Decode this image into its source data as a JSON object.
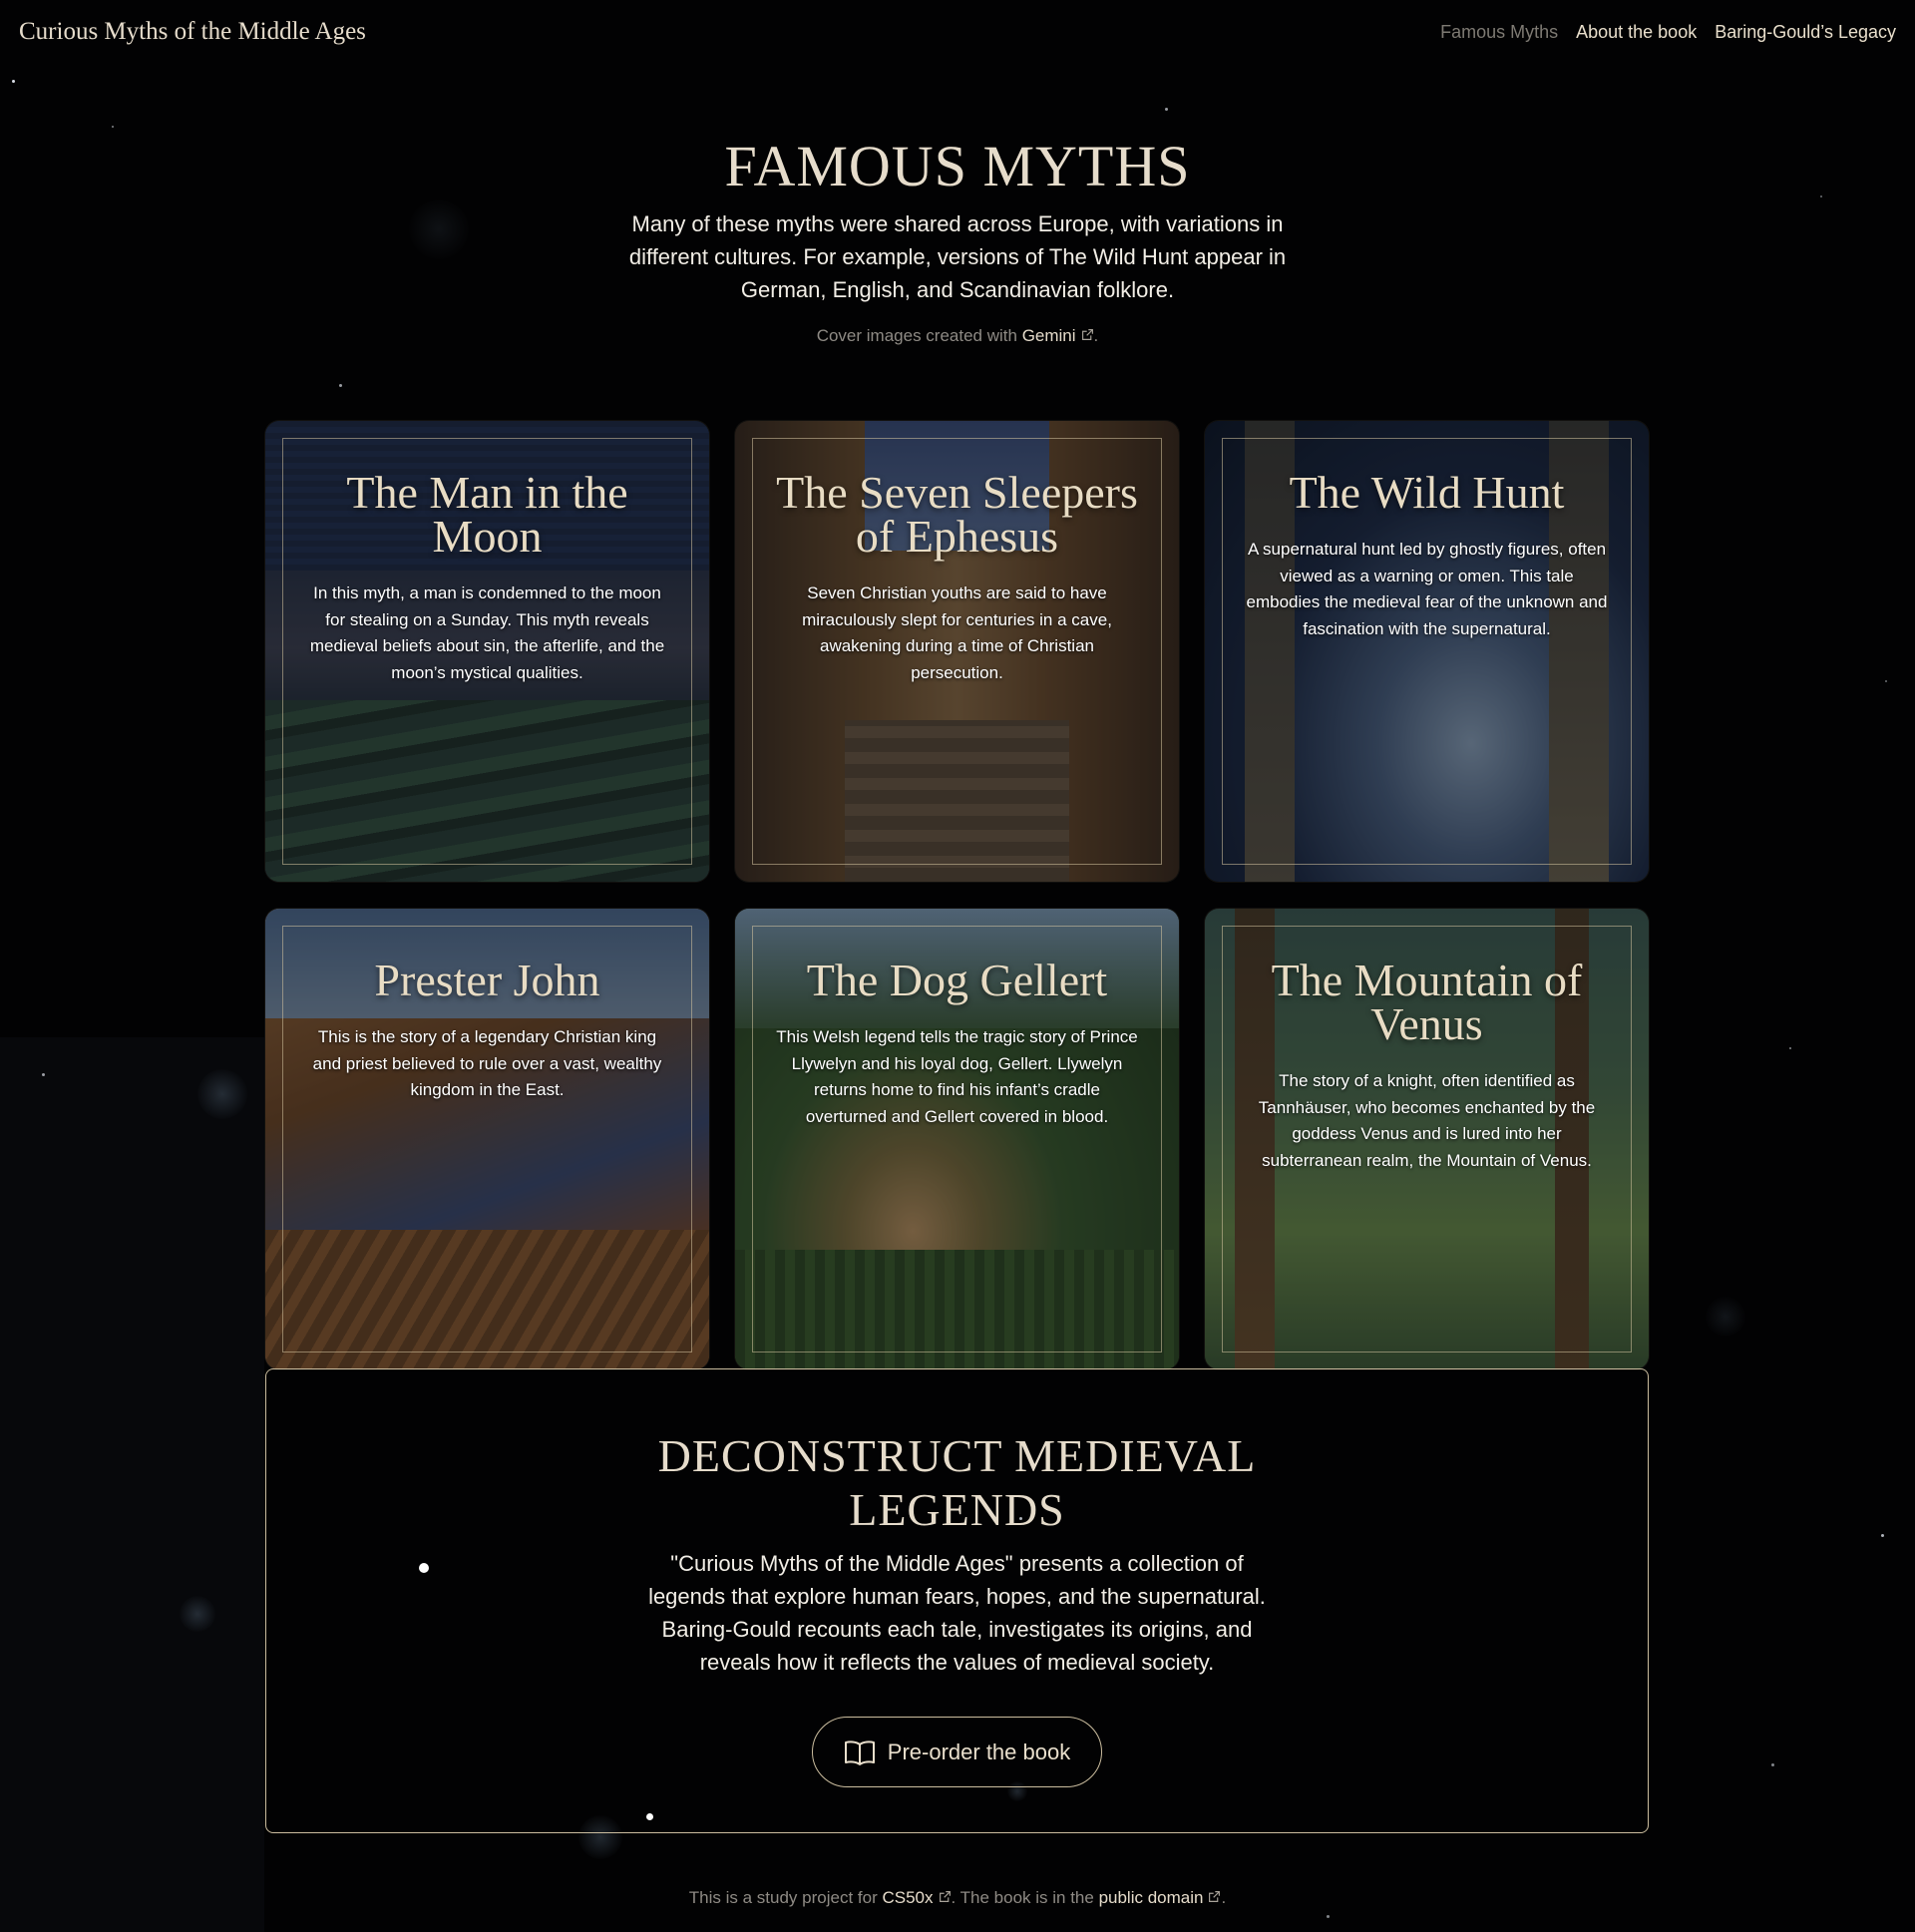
{
  "site": {
    "brand": "Curious Myths of the Middle Ages"
  },
  "nav": [
    {
      "label": "Famous Myths",
      "active": true
    },
    {
      "label": "About the book",
      "active": false
    },
    {
      "label": "Baring-Gould’s Legacy",
      "active": false
    }
  ],
  "intro": {
    "title": "FAMOUS MYTHS",
    "lead": "Many of these myths were shared across Europe, with variations in different cultures. For example, versions of The Wild Hunt appear in German, English, and Scandinavian folklore.",
    "credit_prefix": "Cover images created with ",
    "credit_link": "Gemini",
    "credit_suffix": "."
  },
  "cards": [
    {
      "title": "The Man in the Moon",
      "text": "In this myth, a man is condemned to the moon for stealing on a Sunday. This myth reveals medieval beliefs about sin, the afterlife, and the moon’s mystical qualities."
    },
    {
      "title": "The Seven Sleepers of Ephesus",
      "text": "Seven Christian youths are said to have miraculously slept for centuries in a cave, awakening during a time of Christian persecution."
    },
    {
      "title": "The Wild Hunt",
      "text": "A supernatural hunt led by ghostly figures, often viewed as a warning or omen. This tale embodies the medieval fear of the unknown and fascination with the supernatural."
    },
    {
      "title": "Prester John",
      "text": "This is the story of a legendary Christian king and priest believed to rule over a vast, wealthy kingdom in the East."
    },
    {
      "title": "The Dog Gellert",
      "text": "This Welsh legend tells the tragic story of Prince Llywelyn and his loyal dog, Gellert. Llywelyn returns home to find his infant’s cradle overturned and Gellert covered in blood."
    },
    {
      "title": "The Mountain of Venus",
      "text": "The story of a knight, often identified as Tannhäuser, who becomes enchanted by the goddess Venus and is lured into her subterranean realm, the Mountain of Venus."
    }
  ],
  "cta": {
    "title": "DECONSTRUCT MEDIEVAL LEGENDS",
    "text": "\"Curious Myths of the Middle Ages\" presents a collection of legends that explore human fears, hopes, and the supernatural. Baring-Gould recounts each tale, investigates its origins, and reveals how it reflects the values of medieval society.",
    "button": "Pre-order the book"
  },
  "footer": {
    "prefix": "This is a study project for ",
    "link1": "CS50x",
    "middle": ". The book is in the ",
    "link2": "public domain",
    "suffix": "."
  },
  "colors": {
    "background": "#020203",
    "accent": "#e6dccb",
    "muted": "#8e8a84",
    "border": "#cbbd9f"
  },
  "icons": {
    "external": "external-link-icon",
    "book": "open-book-icon"
  }
}
